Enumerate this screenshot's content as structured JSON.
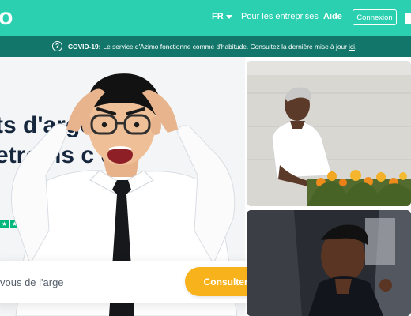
{
  "header": {
    "logo": "mo",
    "language": "FR",
    "nav_enterprises": "Pour les entreprises",
    "nav_help": "Aide",
    "login_label": "Connexion"
  },
  "covid_banner": {
    "info_icon": "?",
    "title": "COVID-19:",
    "message": "Le service d'Azimo fonctionne comme d'habitude. Consultez la dernière mise à jour",
    "link": "ici",
    "end": "."
  },
  "hero": {
    "headline_line1": "ts d'argent ns",
    "headline_line2": "etroins c    da",
    "amount_placeholder": "vous de l'arge",
    "cta_label": "Consulter les tarifs"
  },
  "icons": {
    "info": "info-icon",
    "lang_caret": "chevron-down-icon",
    "rating": "star-icon"
  },
  "colors": {
    "brand_teal": "#2ad0b0",
    "banner_dark_teal": "#12776a",
    "cta_yellow": "#f8b21c",
    "headline_navy": "#16273d",
    "rating_green": "#00b67a"
  }
}
